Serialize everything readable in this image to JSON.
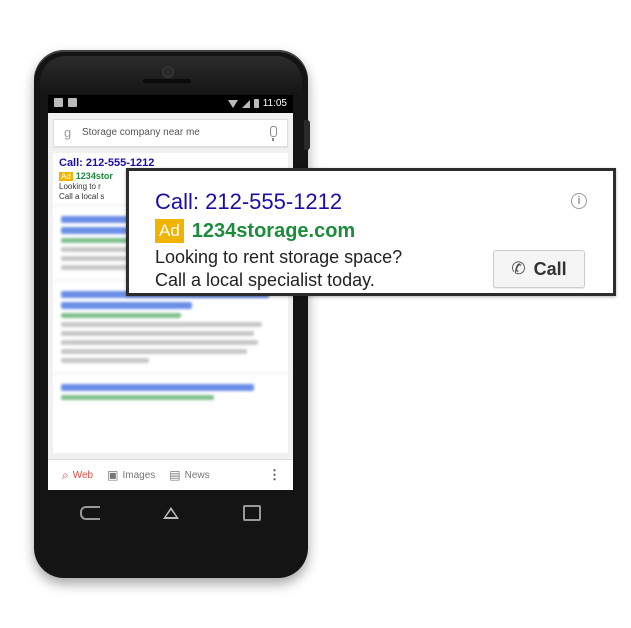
{
  "status_bar": {
    "time": "11:05"
  },
  "search": {
    "query": "Storage company near me",
    "icon": "google-g-icon"
  },
  "mini_ad": {
    "call": "Call: 212-555-1212",
    "badge": "Ad",
    "site": "1234stor",
    "line1": "Looking to r",
    "line2": "Call a local s"
  },
  "bottom_tabs": [
    {
      "label": "Web",
      "icon": "search-icon"
    },
    {
      "label": "Images",
      "icon": "camera-icon"
    },
    {
      "label": "News",
      "icon": "news-icon"
    }
  ],
  "ad": {
    "call_text": "Call: 212-555-1212",
    "badge": "Ad",
    "display_url": "1234storage.com",
    "line1": "Looking to rent storage space?",
    "line2": "Call a local specialist today.",
    "call_button_label": "Call",
    "info_symbol": "i"
  },
  "colors": {
    "link_blue": "#1a0dab",
    "url_green": "#1c8c3c",
    "ad_badge": "#f0b400",
    "active_tab": "#dd4b39"
  }
}
